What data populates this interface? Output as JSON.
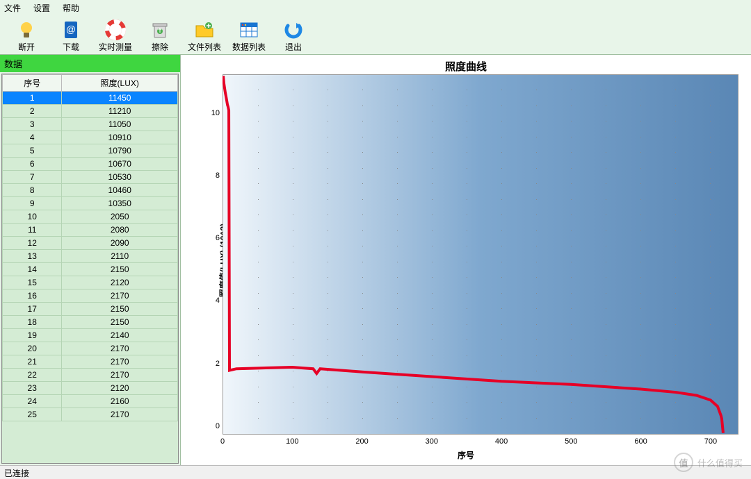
{
  "menu": {
    "file": "文件",
    "settings": "设置",
    "help": "帮助"
  },
  "toolbar": {
    "disconnect": "断开",
    "download": "下载",
    "realtime": "实时测量",
    "erase": "擦除",
    "filelist": "文件列表",
    "datalist": "数据列表",
    "exit": "退出"
  },
  "sidebar": {
    "title": "数据",
    "col_index": "序号",
    "col_lux": "照度(LUX)",
    "rows": [
      {
        "i": 1,
        "v": 11450
      },
      {
        "i": 2,
        "v": 11210
      },
      {
        "i": 3,
        "v": 11050
      },
      {
        "i": 4,
        "v": 10910
      },
      {
        "i": 5,
        "v": 10790
      },
      {
        "i": 6,
        "v": 10670
      },
      {
        "i": 7,
        "v": 10530
      },
      {
        "i": 8,
        "v": 10460
      },
      {
        "i": 9,
        "v": 10350
      },
      {
        "i": 10,
        "v": 2050
      },
      {
        "i": 11,
        "v": 2080
      },
      {
        "i": 12,
        "v": 2090
      },
      {
        "i": 13,
        "v": 2110
      },
      {
        "i": 14,
        "v": 2150
      },
      {
        "i": 15,
        "v": 2120
      },
      {
        "i": 16,
        "v": 2170
      },
      {
        "i": 17,
        "v": 2150
      },
      {
        "i": 18,
        "v": 2150
      },
      {
        "i": 19,
        "v": 2140
      },
      {
        "i": 20,
        "v": 2170
      },
      {
        "i": 21,
        "v": 2170
      },
      {
        "i": 22,
        "v": 2170
      },
      {
        "i": 23,
        "v": 2120
      },
      {
        "i": 24,
        "v": 2160
      },
      {
        "i": 25,
        "v": 2170
      }
    ],
    "selected": 1
  },
  "chart": {
    "title": "照度曲线",
    "ylabel": "照度值(LUX) (10^3)",
    "xlabel": "序号",
    "y_ticks": [
      0,
      2,
      4,
      6,
      8,
      10
    ],
    "x_ticks": [
      0,
      100,
      200,
      300,
      400,
      500,
      600,
      700
    ],
    "y_range": [
      0,
      11.5
    ],
    "x_range": [
      0,
      740
    ]
  },
  "chart_data": {
    "type": "line",
    "title": "照度曲线",
    "xlabel": "序号",
    "ylabel": "照度值(LUX) (10^3)",
    "xlim": [
      0,
      740
    ],
    "ylim": [
      0,
      11.5
    ],
    "series": [
      {
        "name": "照度",
        "x": [
          1,
          2,
          3,
          4,
          5,
          6,
          7,
          8,
          9,
          10,
          20,
          50,
          100,
          130,
          135,
          140,
          200,
          300,
          400,
          500,
          600,
          650,
          680,
          700,
          710,
          715,
          716,
          718
        ],
        "y": [
          11.45,
          11.21,
          11.05,
          10.91,
          10.79,
          10.67,
          10.53,
          10.46,
          10.35,
          2.05,
          2.1,
          2.12,
          2.15,
          2.1,
          1.95,
          2.1,
          2.0,
          1.85,
          1.7,
          1.6,
          1.45,
          1.35,
          1.25,
          1.1,
          0.9,
          0.6,
          0.5,
          0.05
        ]
      }
    ]
  },
  "status": {
    "connected": "已连接"
  },
  "watermark": {
    "logo": "值",
    "text": "什么值得买"
  }
}
